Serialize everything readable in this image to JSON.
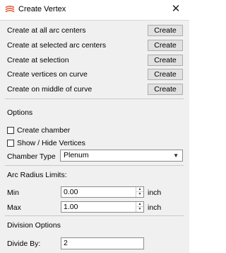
{
  "window": {
    "title": "Create Vertex",
    "icon": "layered-vertex-icon",
    "close_glyph": "✕"
  },
  "actions": [
    {
      "label": "Create at all arc centers",
      "button": "Create"
    },
    {
      "label": "Create at selected arc centers",
      "button": "Create"
    },
    {
      "label": "Create at selection",
      "button": "Create"
    },
    {
      "label": "Create vertices on curve",
      "button": "Create"
    },
    {
      "label": "Create on middle of curve",
      "button": "Create"
    }
  ],
  "options": {
    "heading": "Options",
    "create_chamber": {
      "label": "Create chamber",
      "checked": false
    },
    "show_hide_vertices": {
      "label": "Show / Hide Vertices",
      "checked": false
    },
    "chamber_type": {
      "label": "Chamber Type",
      "value": "Plenum"
    }
  },
  "arc_radius": {
    "heading": "Arc Radius Limits:",
    "min": {
      "label": "Min",
      "value": "0.00",
      "unit": "inch"
    },
    "max": {
      "label": "Max",
      "value": "1.00",
      "unit": "inch"
    }
  },
  "division": {
    "heading": "Division Options",
    "divide_by": {
      "label": "Divide By:",
      "value": "2"
    }
  },
  "colors": {
    "icon_accent": "#e8542a",
    "panel_bg": "#f0f0f0"
  }
}
